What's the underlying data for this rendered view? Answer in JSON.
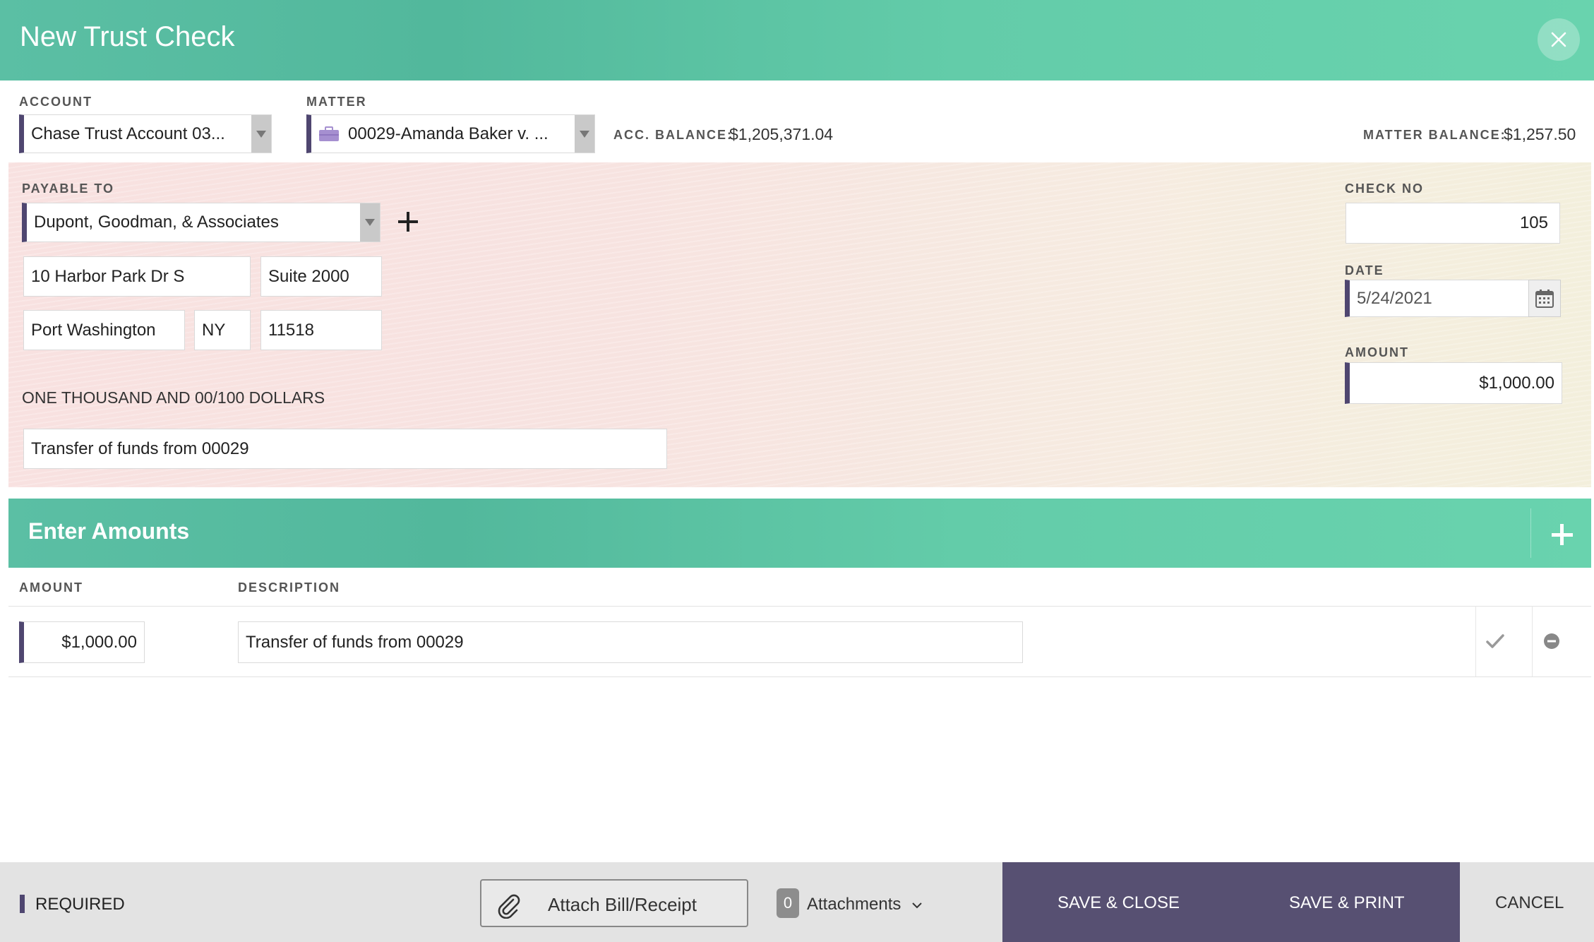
{
  "dialog": {
    "title": "New Trust Check"
  },
  "top": {
    "account_label": "ACCOUNT",
    "account_value": "Chase Trust Account 03...",
    "matter_label": "MATTER",
    "matter_value": "00029-Amanda Baker v. ...",
    "acc_balance_label": "ACC. BALANCE:",
    "acc_balance_value": "$1,205,371.04",
    "matter_balance_label": "MATTER BALANCE:",
    "matter_balance_value": "$1,257.50"
  },
  "check": {
    "payable_label": "PAYABLE TO",
    "payable_value": "Dupont, Goodman, & Associates",
    "address1": "10 Harbor Park Dr S",
    "address2": "Suite 2000",
    "city": "Port Washington",
    "state": "NY",
    "zip": "11518",
    "amount_words": "ONE THOUSAND AND 00/100 DOLLARS",
    "memo": "Transfer of funds from 00029",
    "check_no_label": "CHECK NO",
    "check_no_value": "105",
    "date_label": "DATE",
    "date_value": "5/24/2021",
    "amount_label": "AMOUNT",
    "amount_value": "$1,000.00"
  },
  "amounts": {
    "title": "Enter Amounts",
    "col_amount": "AMOUNT",
    "col_description": "DESCRIPTION",
    "rows": [
      {
        "amount": "$1,000.00",
        "description": "Transfer of funds from 00029"
      }
    ]
  },
  "footer": {
    "required_label": "REQUIRED",
    "attach_label": "Attach Bill/Receipt",
    "attachments_count": "0",
    "attachments_label": "Attachments",
    "save_close": "SAVE & CLOSE",
    "save_print": "SAVE & PRINT",
    "cancel": "CANCEL"
  },
  "colors": {
    "header_teal": "#5bbfa4",
    "required_purple": "#4f4670",
    "save_group": "#575072"
  }
}
